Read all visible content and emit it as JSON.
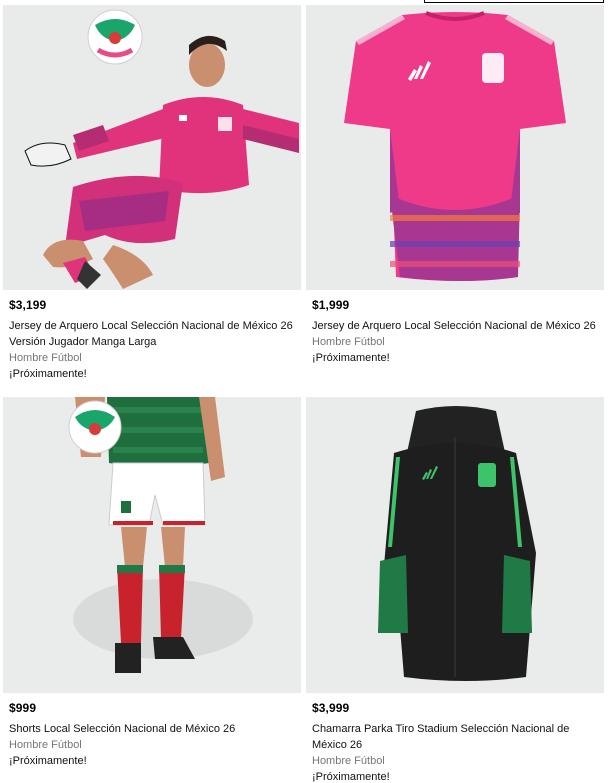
{
  "products": [
    {
      "price": "$3,199",
      "name": "Jersey de Arquero Local Selección Nacional de México 26 Versión Jugador Manga Larga",
      "category": "Hombre Fútbol",
      "status": "¡Próximamente!",
      "image_icon": "goalkeeper-player-photo"
    },
    {
      "price": "$1,999",
      "name": "Jersey de Arquero Local Selección Nacional de México 26",
      "category": "Hombre Fútbol",
      "status": "¡Próximamente!",
      "image_icon": "pink-goalkeeper-jersey"
    },
    {
      "price": "$999",
      "name": "Shorts Local Selección Nacional de México 26",
      "category": "Hombre Fútbol",
      "status": "¡Próximamente!",
      "image_icon": "white-shorts-on-model"
    },
    {
      "price": "$3,999",
      "name": "Chamarra Parka Tiro Stadium Selección Nacional de México 26",
      "category": "Hombre Fútbol",
      "status": "¡Próximamente!",
      "image_icon": "black-parka-jacket"
    }
  ],
  "colors": {
    "pink": "#e8337f",
    "green": "#1f7a45",
    "black": "#1b1b1b",
    "red": "#c8232c"
  }
}
